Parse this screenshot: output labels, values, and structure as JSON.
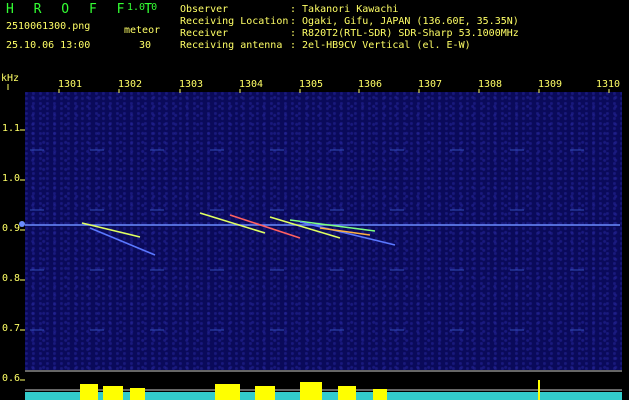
{
  "header": {
    "app_title": "H R O F F T",
    "version": "1.0.0",
    "filename": "2510061300.png",
    "meteor_label": "meteor",
    "datetime": "25.10.06 13:00",
    "meteor_count": "30",
    "info": [
      {
        "key": "Observer",
        "value": ": Takanori Kawachi"
      },
      {
        "key": "Receiving Location",
        "value": ": Ogaki, Gifu, JAPAN (136.60E, 35.35N)"
      },
      {
        "key": "Receiver",
        "value": ": R820T2(RTL-SDR) SDR-Sharp 53.1000MHz"
      },
      {
        "key": "Receiving antenna",
        "value": ": 2el-HB9CV Vertical (el. E-W)"
      }
    ]
  },
  "axis": {
    "y_unit": "kHz",
    "freq_labels": [
      "1.1",
      "1.0",
      "0.9",
      "0.8",
      "0.7",
      "0.6"
    ],
    "time_labels": [
      "1301",
      "1302",
      "1303",
      "1304",
      "1305",
      "1306",
      "1307",
      "1308",
      "1309",
      "1310"
    ]
  },
  "colors": {
    "background": "#000000",
    "header_green": "#33ff33",
    "header_yellow": "#ffff66",
    "plot_blue": "#0a0a5a",
    "carrier_line": "#6b8cff",
    "meteor_trace": "#e0ff60",
    "histogram": "#33cccc",
    "histogram_peak": "#ffff00"
  }
}
